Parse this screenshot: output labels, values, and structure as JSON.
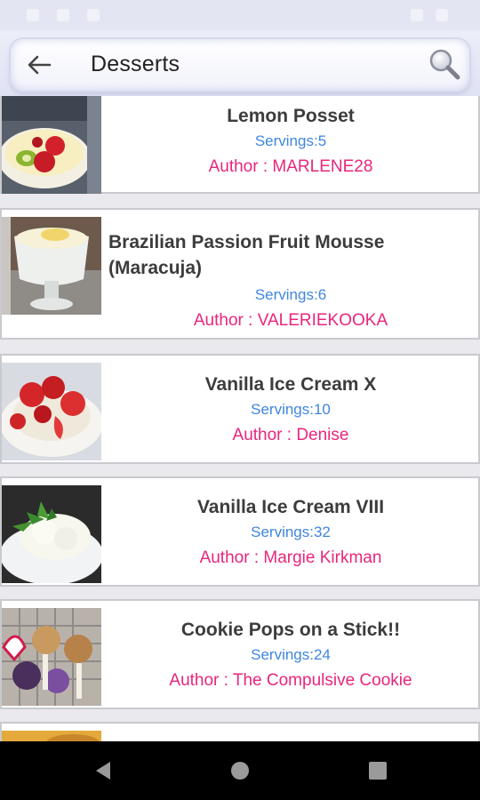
{
  "header": {
    "title": "Desserts",
    "back_icon": "arrow-left-icon",
    "search_icon": "magnifier-icon"
  },
  "recipes": [
    {
      "title": "Lemon Posset",
      "servings": "Servings:5",
      "author": "Author : MARLENE28"
    },
    {
      "title": "Brazilian Passion Fruit Mousse (Maracuja)",
      "servings": "Servings:6",
      "author": "Author : VALERIEKOOKA"
    },
    {
      "title": "Vanilla Ice Cream X",
      "servings": "Servings:10",
      "author": "Author : Denise"
    },
    {
      "title": "Vanilla Ice Cream VIII",
      "servings": "Servings:32",
      "author": "Author : Margie Kirkman"
    },
    {
      "title": "Cookie Pops on a Stick!!",
      "servings": "Servings:24",
      "author": "Author : The Compulsive Cookie"
    }
  ],
  "colors": {
    "servings": "#3f86de",
    "author": "#e8267c",
    "title": "#3c3c3c",
    "header_bg": "#e4e5f3"
  },
  "nav": {
    "back": "triangle-back-icon",
    "home": "circle-home-icon",
    "recents": "square-recents-icon"
  }
}
